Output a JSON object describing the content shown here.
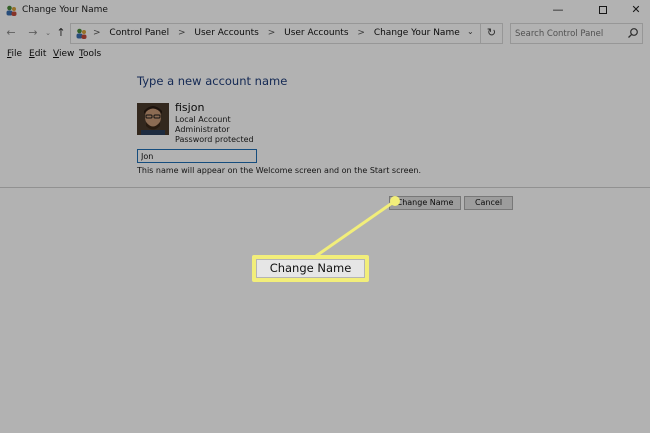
{
  "window": {
    "title": "Change Your Name",
    "controls": {
      "minimize": "—",
      "close": "✕"
    }
  },
  "navigation": {
    "back_icon": "arrow-left-icon",
    "forward_icon": "arrow-right-icon",
    "recent_icon": "chevron-down-icon",
    "up_icon": "arrow-up-icon",
    "up_glyph": "↑",
    "back_glyph": "←",
    "fwd_glyph": "→",
    "drop_glyph": "⌄",
    "refresh_glyph": "↻"
  },
  "breadcrumb": [
    "Control Panel",
    "User Accounts",
    "User Accounts",
    "Change Your Name"
  ],
  "breadcrumb_separator": ">",
  "search": {
    "placeholder": "Search Control Panel"
  },
  "menu": [
    "File",
    "Edit",
    "View",
    "Tools"
  ],
  "page": {
    "heading": "Type a new account name",
    "user": {
      "name": "fisjon",
      "type": "Local Account",
      "role": "Administrator",
      "password_status": "Password protected"
    },
    "new_name_value": "Jon",
    "hint": "This name will appear on the Welcome screen and on the Start screen.",
    "buttons": {
      "change": "Change Name",
      "cancel": "Cancel"
    }
  },
  "callout": {
    "label": "Change Name"
  },
  "colors": {
    "heading": "#1f3d7a",
    "callout": "#f2ee7a",
    "input_border": "#1f6fb5"
  }
}
